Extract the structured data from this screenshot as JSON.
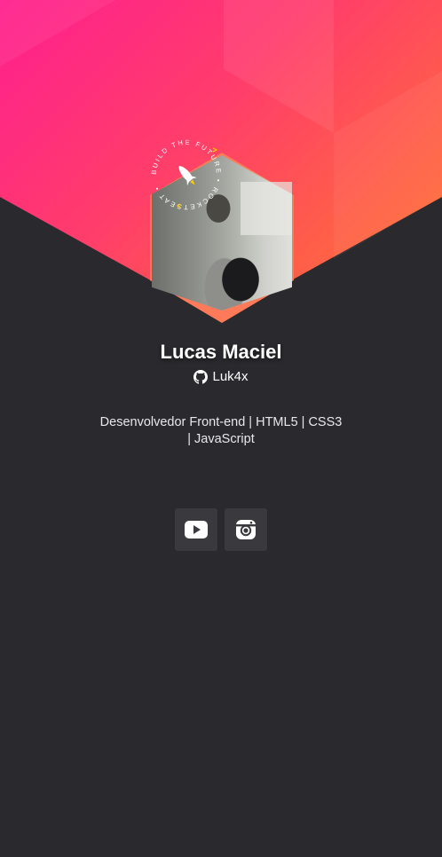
{
  "profile": {
    "name": "Lucas Maciel",
    "github_username": "Luk4x",
    "bio": "Desenvolvedor Front-end | HTML5 | CSS3 | JavaScript"
  },
  "badge": {
    "ring_text": "BUILD THE FUTURE • ROCKETSEAT •",
    "color": "#ffffff",
    "accent": "#ffcc00"
  },
  "social": [
    {
      "name": "YouTube",
      "icon": "youtube-icon"
    },
    {
      "name": "Instagram",
      "icon": "instagram-icon"
    }
  ],
  "colors": {
    "background": "#2a2a2e",
    "gradient_start": "#ff1f8e",
    "gradient_end": "#ffa640",
    "button_bg": "#3a3a3e",
    "text": "#ffffff"
  }
}
